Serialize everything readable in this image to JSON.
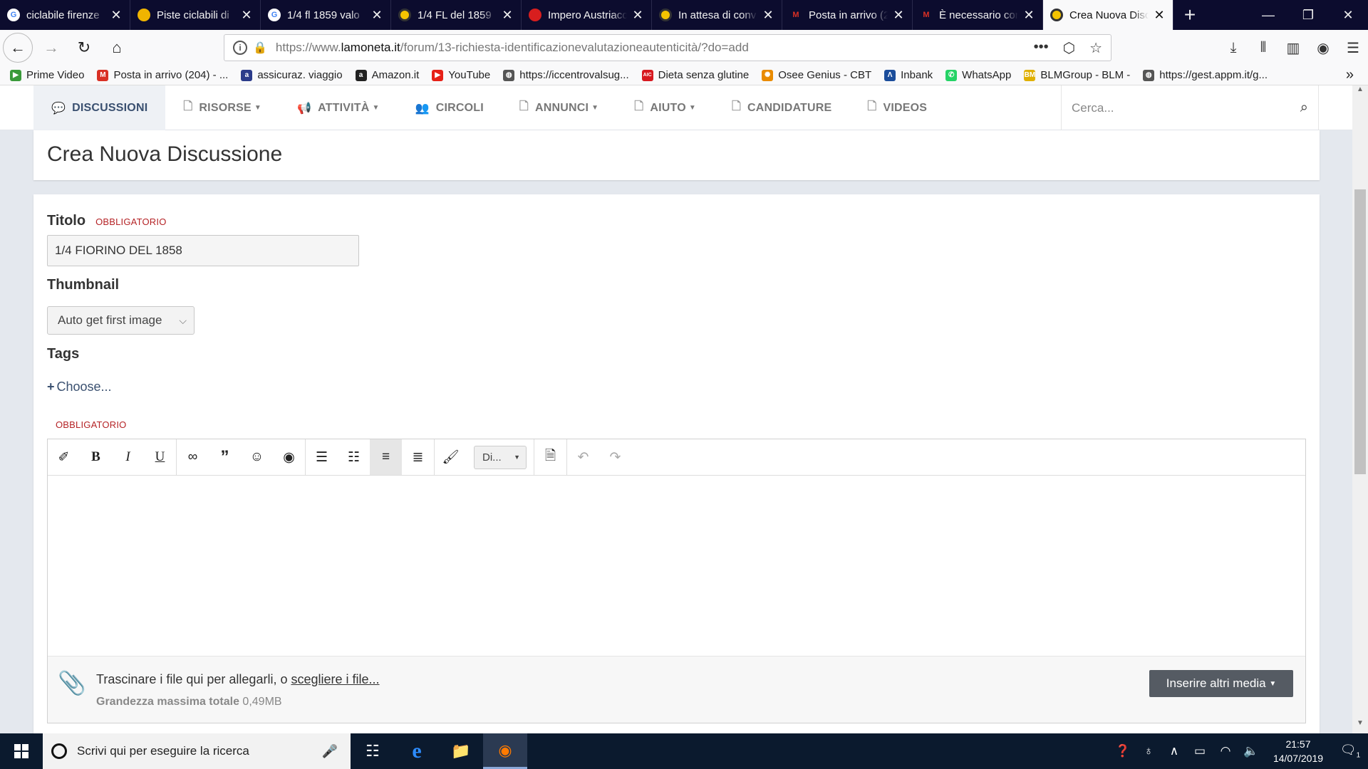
{
  "browser": {
    "tabs": [
      {
        "title": "ciclabile firenze",
        "icon": "google-icon",
        "color": "#ffffff"
      },
      {
        "title": "Piste ciclabili di",
        "icon": "bike-icon",
        "color": "#f0b400"
      },
      {
        "title": "1/4 fl 1859 valo",
        "icon": "google-icon",
        "color": "#ffffff"
      },
      {
        "title": "1/4 FL del 1859",
        "icon": "coin-icon",
        "color": "#f5c400"
      },
      {
        "title": "Impero Austriaco",
        "icon": "coin-red-icon",
        "color": "#d81e1e"
      },
      {
        "title": "In attesa di conv",
        "icon": "coin-icon",
        "color": "#f5c400"
      },
      {
        "title": "Posta in arrivo (2",
        "icon": "gmail-icon",
        "color": "#d93025"
      },
      {
        "title": "È necessario con",
        "icon": "gmail-icon",
        "color": "#d93025"
      },
      {
        "title": "Crea Nuova Disc",
        "icon": "coin-icon",
        "color": "#f5c400"
      }
    ],
    "url_pre": "https://www.",
    "url_host": "lamoneta.it",
    "url_post": "/forum/13-richiesta-identificazionevalutazioneautenticità/?do=add",
    "bookmarks": [
      {
        "label": "Prime Video",
        "color": "#3a9a3a",
        "glyph": "▶"
      },
      {
        "label": "Posta in arrivo (204) - ...",
        "color": "#d93025",
        "glyph": "M"
      },
      {
        "label": "assicuraz. viaggio",
        "color": "#2b3b8a",
        "glyph": "a"
      },
      {
        "label": "Amazon.it",
        "color": "#222222",
        "glyph": "a"
      },
      {
        "label": "YouTube",
        "color": "#e62117",
        "glyph": "▶"
      },
      {
        "label": "https://iccentrovalsug...",
        "color": "#555555",
        "glyph": "◍"
      },
      {
        "label": "Dieta senza glutine",
        "color": "#d71920",
        "glyph": "AIC"
      },
      {
        "label": "Osee Genius - CBT",
        "color": "#e98b00",
        "glyph": "✺"
      },
      {
        "label": "Inbank",
        "color": "#1b4d9b",
        "glyph": "Λ"
      },
      {
        "label": "WhatsApp",
        "color": "#25d366",
        "glyph": "✆"
      },
      {
        "label": "BLMGroup - BLM -",
        "color": "#e0b000",
        "glyph": "BM"
      },
      {
        "label": "https://gest.appm.it/g...",
        "color": "#555555",
        "glyph": "◍"
      }
    ]
  },
  "site": {
    "nav": [
      {
        "label": "DISCUSSIONI",
        "icon": "chat-icon",
        "glyph": "💬",
        "caret": false,
        "active": true
      },
      {
        "label": "RISORSE",
        "icon": "doc-icon",
        "glyph": "🗋",
        "caret": true,
        "active": false
      },
      {
        "label": "ATTIVITÀ",
        "icon": "megaphone-icon",
        "glyph": "📢",
        "caret": true,
        "active": false
      },
      {
        "label": "CIRCOLI",
        "icon": "users-icon",
        "glyph": "👥",
        "caret": false,
        "active": false
      },
      {
        "label": "ANNUNCI",
        "icon": "doc-icon",
        "glyph": "🗋",
        "caret": true,
        "active": false
      },
      {
        "label": "AIUTO",
        "icon": "doc-icon",
        "glyph": "🗋",
        "caret": true,
        "active": false
      },
      {
        "label": "CANDIDATURE",
        "icon": "doc-icon",
        "glyph": "🗋",
        "caret": false,
        "active": false
      },
      {
        "label": "VIDEOS",
        "icon": "doc-icon",
        "glyph": "🗋",
        "caret": false,
        "active": false
      }
    ],
    "search_placeholder": "Cerca..."
  },
  "page": {
    "heading": "Crea Nuova Discussione",
    "title_label": "Titolo",
    "required": "OBBLIGATORIO",
    "title_value": "1/4 FIORINO DEL 1858",
    "thumbnail_label": "Thumbnail",
    "thumbnail_value": "Auto get first image",
    "tags_label": "Tags",
    "tags_choose": "Choose...",
    "editor_required": "OBBLIGATORIO",
    "format_drop": "Di...",
    "attach_text": "Trascinare i file qui per allegarli, o ",
    "attach_link": "scegliere i file...",
    "max_label": "Grandezza massima totale",
    "max_value": "0,49MB",
    "media_button": "Inserire altri media"
  },
  "taskbar": {
    "search": "Scrivi qui per eseguire la ricerca",
    "time": "21:57",
    "date": "14/07/2019",
    "notif_count": "1"
  }
}
